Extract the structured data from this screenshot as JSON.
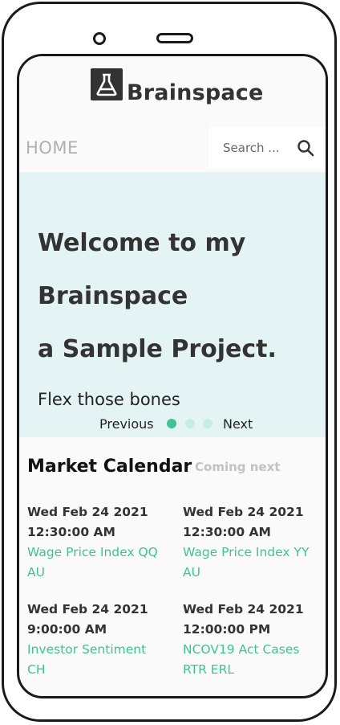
{
  "app": {
    "brand": "Brainspace"
  },
  "nav": {
    "home": "HOME"
  },
  "search": {
    "placeholder": "Search ..."
  },
  "hero": {
    "line1": "Welcome to my",
    "line2": "Brainspace",
    "line3": "a Sample Project.",
    "subtitle": "Flex those bones",
    "previous": "Previous",
    "next": "Next",
    "active_slide": 1,
    "slide_count": 3
  },
  "market": {
    "title": "Market Calendar",
    "subtitle": "Coming next",
    "events": [
      {
        "date": "Wed Feb 24 2021",
        "time": "12:30:00 AM",
        "name_line1": "Wage Price Index QQ",
        "name_line2": "AU"
      },
      {
        "date": "Wed Feb 24 2021",
        "time": "12:30:00 AM",
        "name_line1": "Wage Price Index YY",
        "name_line2": "AU"
      },
      {
        "date": "Wed Feb 24 2021",
        "time": "9:00:00 AM",
        "name_line1": "Investor Sentiment",
        "name_line2": "CH"
      },
      {
        "date": "Wed Feb 24 2021",
        "time": "12:00:00 PM",
        "name_line1": "NCOV19 Act Cases",
        "name_line2": "RTR ERL"
      }
    ]
  },
  "colors": {
    "accent": "#3fc393",
    "hero_bg": "#e4f4f4",
    "dot_inactive": "#c9ece0",
    "text_dark": "#333333"
  },
  "icons": {
    "logo": "flask-icon",
    "search": "search-icon"
  }
}
